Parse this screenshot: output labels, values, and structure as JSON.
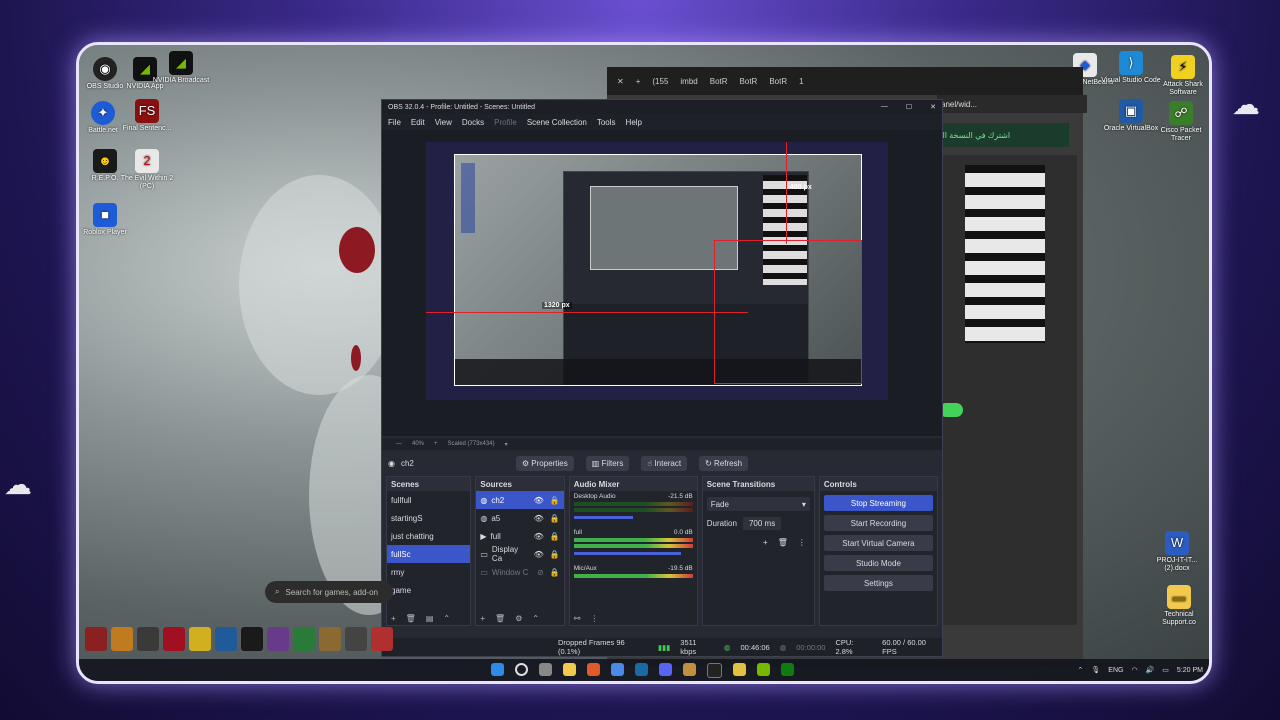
{
  "desktop": {
    "left_icons": [
      {
        "label": "OBS Studio",
        "icon": "obs-icon",
        "color": "#222"
      },
      {
        "label": "NVIDIA App",
        "icon": "nvidia-icon",
        "color": "#0a0a0a"
      },
      {
        "label": "NVIDIA Broadcast",
        "icon": "nvidia-broadcast-icon",
        "color": "#0a0a0a"
      },
      {
        "label": "Battle.net",
        "icon": "battlenet-icon",
        "color": "#1e5bd6"
      },
      {
        "label": "Final Sentenc...",
        "icon": "final-sentence-icon",
        "color": "#8a1010"
      },
      {
        "label": "R.E.P.O.",
        "icon": "repo-icon",
        "color": "#ffcc00"
      },
      {
        "label": "The Evil Within 2 (PC)",
        "icon": "evil-within-icon",
        "color": "#c01010"
      },
      {
        "label": "Roblox Player",
        "icon": "roblox-icon",
        "color": "#1e5bd6"
      }
    ],
    "right_icons": [
      {
        "label": "Apache NetBeans",
        "icon": "netbeans-icon"
      },
      {
        "label": "Visual Studio Code",
        "icon": "vscode-icon"
      },
      {
        "label": "Attack Shark Software",
        "icon": "attack-shark-icon"
      },
      {
        "label": "Oracle VirtualBox",
        "icon": "virtualbox-icon"
      },
      {
        "label": "Cisco Packet Tracer",
        "icon": "cisco-icon"
      },
      {
        "label": "PROJ-IT-IT... (2).docx",
        "icon": "word-doc-icon"
      },
      {
        "label": "Technical Support.co",
        "icon": "folder-icon"
      }
    ],
    "search_placeholder": "Search for games, add-on"
  },
  "browser": {
    "tabs": [
      "(155",
      "imbd",
      "BotR",
      "BotR",
      "BotR",
      "1"
    ],
    "url_fragment": "anel/wid...",
    "arabic_banner": "اشترك في النسخة الم"
  },
  "obs": {
    "title": "OBS 32.0.4 - Profile: Untitled - Scenes: Untitled",
    "menu": [
      "File",
      "Edit",
      "View",
      "Docks",
      "Profile",
      "Scene Collection",
      "Tools",
      "Help"
    ],
    "preview": {
      "width_label": "1320 px",
      "height_label": "480 px",
      "zoom": "40%",
      "scaled": "Scaled (773x434)"
    },
    "current_scene": "ch2",
    "scene_buttons": [
      "Properties",
      "Filters",
      "Interact",
      "Refresh"
    ],
    "scenes": {
      "title": "Scenes",
      "items": [
        "fullfull",
        "startingS",
        "just chatting",
        "fullSc",
        "rmy",
        "game"
      ],
      "selected": 3
    },
    "sources": {
      "title": "Sources",
      "items": [
        "ch2",
        "a5",
        "full",
        "Display Ca",
        "Window C"
      ]
    },
    "mixer": {
      "title": "Audio Mixer",
      "channels": [
        {
          "name": "Desktop Audio",
          "db": "-21.5 dB"
        },
        {
          "name": "full",
          "db": "0.0 dB"
        },
        {
          "name": "Mic/Aux",
          "db": "-19.5 dB"
        }
      ]
    },
    "transitions": {
      "title": "Scene Transitions",
      "type": "Fade",
      "duration_label": "Duration",
      "duration": "700 ms"
    },
    "controls": {
      "title": "Controls",
      "buttons": [
        "Stop Streaming",
        "Start Recording",
        "Start Virtual Camera",
        "Studio Mode",
        "Settings"
      ]
    },
    "status": {
      "dropped": "Dropped Frames 96 (0.1%)",
      "bitrate": "3511 kbps",
      "stream_time": "00:46:06",
      "rec_time": "00:00:00",
      "cpu": "CPU: 2.8%",
      "fps": "60.00 / 60.00 FPS"
    }
  },
  "taskbar": {
    "lang": "ENG",
    "time": "5:20 PM"
  },
  "colors": {
    "accent": "#3a56c8",
    "live_green": "#45c553",
    "selection_red": "#e0202a"
  }
}
